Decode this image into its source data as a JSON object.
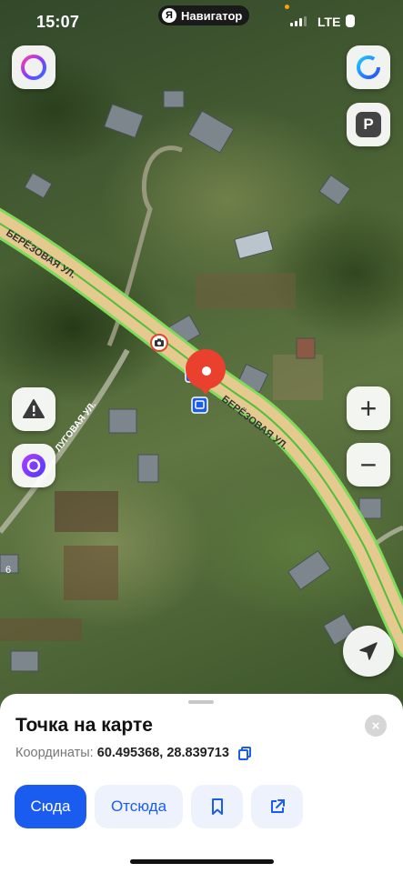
{
  "status_bar": {
    "time": "15:07",
    "app_badge": "Я",
    "app_name": "Навигатор",
    "network": "LTE"
  },
  "map": {
    "street_name": "БЕРЁЗОВАЯ УЛ.",
    "side_street_name": "ЛУГОВАЯ УЛ.",
    "edge_label": "6",
    "road_color": "#e6c98f",
    "road_edge_color": "#7edc5a",
    "marker_color": "#e9412e",
    "bus_stop_color": "#1a5cf0",
    "icons": [
      "alice-icon",
      "parking-icon",
      "warning-icon",
      "zoom-in-icon",
      "zoom-out-icon",
      "navigation-arrow-icon",
      "camera-icon",
      "bus-stop-icon",
      "location-pin-icon"
    ]
  },
  "controls": {
    "zoom_in": "+",
    "zoom_out": "−",
    "parking": "P"
  },
  "sheet": {
    "title": "Точка на карте",
    "coords_label": "Координаты:",
    "coords_value": "60.495368, 28.839713",
    "close_icon": "×",
    "buttons": {
      "here": "Сюда",
      "from": "Отсюда"
    },
    "accent": "#1a5cf0"
  }
}
